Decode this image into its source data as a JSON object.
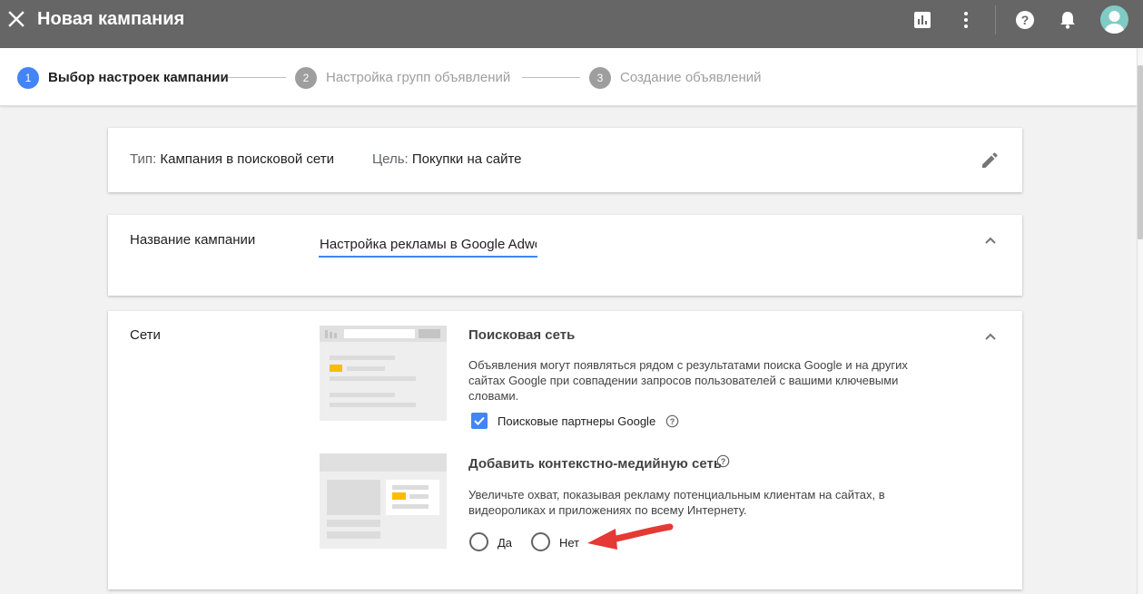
{
  "header": {
    "title": "Новая кампания",
    "icons": [
      "close-icon",
      "reports-icon",
      "more-vert-icon",
      "help-icon",
      "notifications-icon",
      "account-avatar"
    ]
  },
  "stepper": {
    "steps": [
      {
        "num": "1",
        "label": "Выбор настроек кампании",
        "active": true
      },
      {
        "num": "2",
        "label": "Настройка групп объявлений",
        "active": false
      },
      {
        "num": "3",
        "label": "Создание объявлений",
        "active": false
      }
    ]
  },
  "summary": {
    "type_prefix": "Тип:",
    "type_value": "Кампания в поисковой сети",
    "goal_prefix": "Цель:",
    "goal_value": "Покупки на сайте",
    "edit_icon": "pencil-icon"
  },
  "campaign_name": {
    "label": "Название кампании",
    "value": "Настройка рекламы в Google Adwords"
  },
  "networks": {
    "label": "Сети",
    "search": {
      "title": "Поисковая сеть",
      "description": "Объявления могут появляться рядом с результатами поиска Google и на других сайтах Google при совпадении запросов пользователей с вашими ключевыми словами.",
      "partners_label": "Поисковые партнеры Google",
      "partners_checked": true
    },
    "display": {
      "title": "Добавить контекстно-медийную сеть",
      "description": "Увеличьте охват, показывая рекламу потенциальным клиентам на сайтах, в видеороликах и приложениях по всему Интернету.",
      "option_yes": "Да",
      "option_no": "Нет"
    }
  },
  "colors": {
    "topbar": "#666666",
    "accent": "#4285f4",
    "step_inactive": "#9e9e9e",
    "annotation_arrow": "#e53935",
    "illustration_highlight": "#fbbc04"
  }
}
